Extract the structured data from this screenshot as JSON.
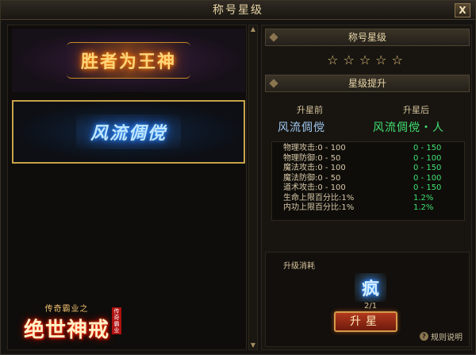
{
  "window": {
    "title": "称号星级",
    "close_label": "X"
  },
  "left": {
    "titles": [
      {
        "text": "胜者为王神",
        "style": "gold"
      },
      {
        "text": "风流倜傥",
        "style": "blue"
      }
    ],
    "logo": {
      "sub": "传奇霸业之",
      "main": "绝世神戒",
      "tag": "传奇霸业"
    }
  },
  "right": {
    "star_header": "称号星级",
    "stars": "☆☆☆☆☆",
    "upgrade_header": "星级提升",
    "before_label": "升星前",
    "after_label": "升星后",
    "before_name": "风流倜傥",
    "after_name": "风流倜傥・人",
    "stats": [
      {
        "before": "物理攻击:0 - 100",
        "after": "0 - 150"
      },
      {
        "before": "物理防御:0 - 50",
        "after": "0 - 100"
      },
      {
        "before": "魔法攻击:0 - 100",
        "after": "0 - 150"
      },
      {
        "before": "魔法防御:0 - 50",
        "after": "0 - 100"
      },
      {
        "before": "道术攻击:0 - 100",
        "after": "0 - 150"
      },
      {
        "before": "生命上限百分比:1%",
        "after": "1.2%"
      },
      {
        "before": "内功上限百分比:1%",
        "after": "1.2%"
      }
    ],
    "cost": {
      "label": "升级消耗",
      "item_text": "疯",
      "count": "2/1",
      "button": "升星",
      "rules": "规则说明"
    }
  },
  "colors": {
    "accent_gold": "#e9c77a",
    "green": "#3fe070",
    "blue_name": "#9fc8f0",
    "button_red": "#b2391e"
  }
}
